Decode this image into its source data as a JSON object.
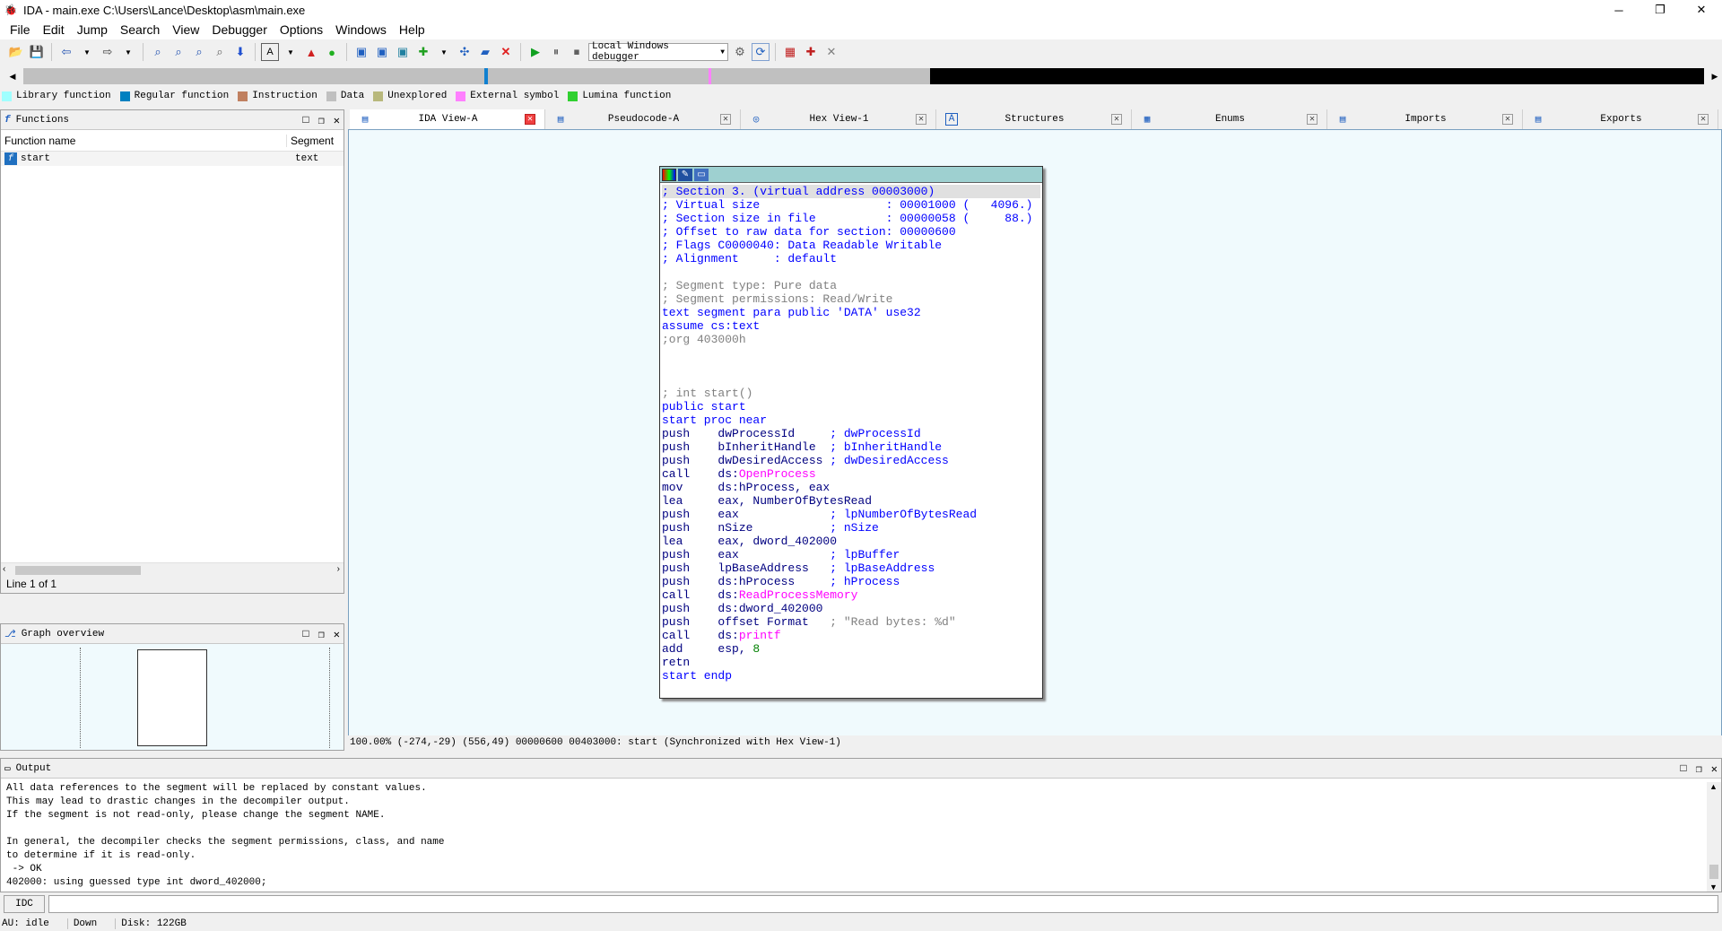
{
  "window": {
    "title": "IDA - main.exe C:\\Users\\Lance\\Desktop\\asm\\main.exe",
    "min": "─",
    "max": "❐",
    "close": "✕"
  },
  "menu": [
    "File",
    "Edit",
    "Jump",
    "Search",
    "View",
    "Debugger",
    "Options",
    "Windows",
    "Help"
  ],
  "toolbar": {
    "debugger_select": "Local Windows debugger"
  },
  "legend": [
    {
      "label": "Library function",
      "color": "#a0ffff"
    },
    {
      "label": "Regular function",
      "color": "#0080c0"
    },
    {
      "label": "Instruction",
      "color": "#c08060"
    },
    {
      "label": "Data",
      "color": "#c0c0c0"
    },
    {
      "label": "Unexplored",
      "color": "#b8b87c"
    },
    {
      "label": "External symbol",
      "color": "#ff80ff"
    },
    {
      "label": "Lumina function",
      "color": "#30d030"
    }
  ],
  "functions": {
    "title": "Functions",
    "col_name": "Function name",
    "col_segment": "Segment",
    "rows": [
      {
        "name": "start",
        "segment": "text"
      }
    ],
    "status": "Line 1 of 1"
  },
  "graph_overview": {
    "title": "Graph overview"
  },
  "tabs": [
    {
      "label": "IDA View-A",
      "icon": "▤"
    },
    {
      "label": "Pseudocode-A",
      "icon": "▤"
    },
    {
      "label": "Hex View-1",
      "icon": "◎"
    },
    {
      "label": "Structures",
      "icon": "A"
    },
    {
      "label": "Enums",
      "icon": "▦"
    },
    {
      "label": "Imports",
      "icon": "▤"
    },
    {
      "label": "Exports",
      "icon": "▤"
    }
  ],
  "asm_lines": [
    {
      "parts": [
        {
          "t": "; Section 3. (virtual address 00003000)",
          "c": "c-blue"
        }
      ],
      "hl": true
    },
    {
      "parts": [
        {
          "t": "; Virtual size                  : 00001000 (   4096.)",
          "c": "c-blue"
        }
      ]
    },
    {
      "parts": [
        {
          "t": "; Section size in file          : 00000058 (     88.)",
          "c": "c-blue"
        }
      ]
    },
    {
      "parts": [
        {
          "t": "; Offset to raw data for section: 00000600",
          "c": "c-blue"
        }
      ]
    },
    {
      "parts": [
        {
          "t": "; Flags C0000040: Data Readable Writable",
          "c": "c-blue"
        }
      ]
    },
    {
      "parts": [
        {
          "t": "; Alignment     : default",
          "c": "c-blue"
        }
      ]
    },
    {
      "parts": [
        {
          "t": "",
          "c": ""
        }
      ]
    },
    {
      "parts": [
        {
          "t": "; Segment type: Pure data",
          "c": "c-grey"
        }
      ]
    },
    {
      "parts": [
        {
          "t": "; Segment permissions: Read/Write",
          "c": "c-grey"
        }
      ]
    },
    {
      "parts": [
        {
          "t": "text segment para public 'DATA' use32",
          "c": "c-blue"
        }
      ]
    },
    {
      "parts": [
        {
          "t": "assume cs:text",
          "c": "c-blue"
        }
      ]
    },
    {
      "parts": [
        {
          "t": ";org 403000h",
          "c": "c-grey"
        }
      ]
    },
    {
      "parts": [
        {
          "t": "",
          "c": ""
        }
      ]
    },
    {
      "parts": [
        {
          "t": "",
          "c": ""
        }
      ]
    },
    {
      "parts": [
        {
          "t": "",
          "c": ""
        }
      ]
    },
    {
      "parts": [
        {
          "t": "; int start()",
          "c": "c-grey"
        }
      ]
    },
    {
      "parts": [
        {
          "t": "public start",
          "c": "c-blue"
        }
      ]
    },
    {
      "parts": [
        {
          "t": "start proc near",
          "c": "c-blue"
        }
      ]
    },
    {
      "parts": [
        {
          "t": "push    dwProcessId     ",
          "c": "c-navy"
        },
        {
          "t": "; dwProcessId",
          "c": "c-blue"
        }
      ]
    },
    {
      "parts": [
        {
          "t": "push    bInheritHandle  ",
          "c": "c-navy"
        },
        {
          "t": "; bInheritHandle",
          "c": "c-blue"
        }
      ]
    },
    {
      "parts": [
        {
          "t": "push    dwDesiredAccess ",
          "c": "c-navy"
        },
        {
          "t": "; dwDesiredAccess",
          "c": "c-blue"
        }
      ]
    },
    {
      "parts": [
        {
          "t": "call    ds:",
          "c": "c-navy"
        },
        {
          "t": "OpenProcess",
          "c": "c-pink"
        }
      ]
    },
    {
      "parts": [
        {
          "t": "mov     ds:hProcess, eax",
          "c": "c-navy"
        }
      ]
    },
    {
      "parts": [
        {
          "t": "lea     eax, NumberOfBytesRead",
          "c": "c-navy"
        }
      ]
    },
    {
      "parts": [
        {
          "t": "push    eax             ",
          "c": "c-navy"
        },
        {
          "t": "; lpNumberOfBytesRead",
          "c": "c-blue"
        }
      ]
    },
    {
      "parts": [
        {
          "t": "push    nSize           ",
          "c": "c-navy"
        },
        {
          "t": "; nSize",
          "c": "c-blue"
        }
      ]
    },
    {
      "parts": [
        {
          "t": "lea     eax, dword_402000",
          "c": "c-navy"
        }
      ]
    },
    {
      "parts": [
        {
          "t": "push    eax             ",
          "c": "c-navy"
        },
        {
          "t": "; lpBuffer",
          "c": "c-blue"
        }
      ]
    },
    {
      "parts": [
        {
          "t": "push    lpBaseAddress   ",
          "c": "c-navy"
        },
        {
          "t": "; lpBaseAddress",
          "c": "c-blue"
        }
      ]
    },
    {
      "parts": [
        {
          "t": "push    ds:hProcess     ",
          "c": "c-navy"
        },
        {
          "t": "; hProcess",
          "c": "c-blue"
        }
      ]
    },
    {
      "parts": [
        {
          "t": "call    ds:",
          "c": "c-navy"
        },
        {
          "t": "ReadProcessMemory",
          "c": "c-pink"
        }
      ]
    },
    {
      "parts": [
        {
          "t": "push    ds:dword_402000",
          "c": "c-navy"
        }
      ]
    },
    {
      "parts": [
        {
          "t": "push    offset Format   ",
          "c": "c-navy"
        },
        {
          "t": "; \"Read bytes: %d\"",
          "c": "c-grey"
        }
      ]
    },
    {
      "parts": [
        {
          "t": "call    ds:",
          "c": "c-navy"
        },
        {
          "t": "printf",
          "c": "c-pink"
        }
      ]
    },
    {
      "parts": [
        {
          "t": "add     esp, ",
          "c": "c-navy"
        },
        {
          "t": "8",
          "c": "c-green"
        }
      ]
    },
    {
      "parts": [
        {
          "t": "retn",
          "c": "c-navy"
        }
      ]
    },
    {
      "parts": [
        {
          "t": "start endp",
          "c": "c-blue"
        }
      ]
    }
  ],
  "view_status": "100.00% (-274,-29) (556,49) 00000600 00403000: start (Synchronized with Hex View-1)",
  "output": {
    "title": "Output",
    "lines": [
      "All data references to the segment will be replaced by constant values.",
      "This may lead to drastic changes in the decompiler output.",
      "If the segment is not read-only, please change the segment NAME.",
      "",
      "In general, the decompiler checks the segment permissions, class, and name",
      "to determine if it is read-only.",
      " -> OK",
      "402000: using guessed type int dword_402000;"
    ]
  },
  "idc_label": "IDC",
  "statusbar": {
    "au": "AU:  idle",
    "dir": "Down",
    "disk": "Disk: 122GB"
  }
}
